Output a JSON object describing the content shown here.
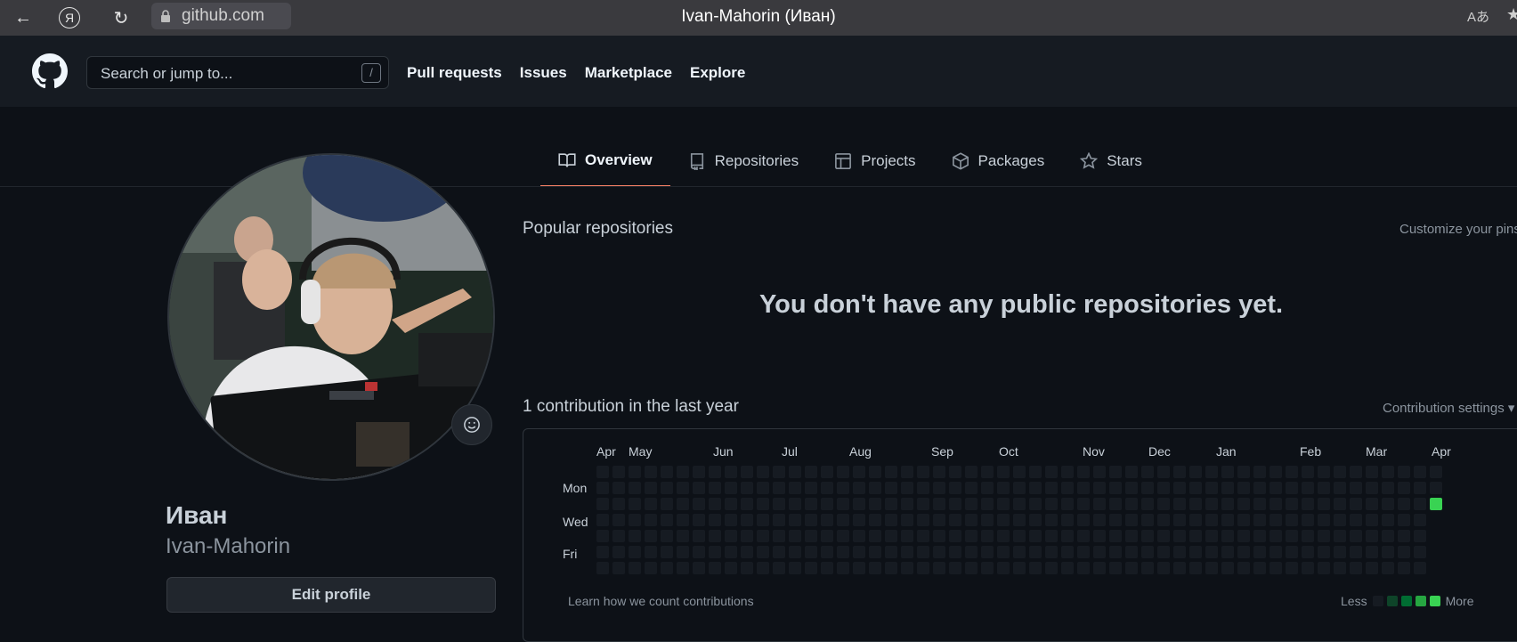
{
  "browser": {
    "url": "github.com",
    "window_title": "Ivan-Mahorin (Иван)",
    "back_glyph": "←",
    "yandex_glyph": "Я",
    "reload_glyph": "↻",
    "translate_glyph": "Aあ",
    "bookmark_glyph": "★"
  },
  "header": {
    "search_placeholder": "Search or jump to...",
    "search_shortcut": "/",
    "nav": [
      "Pull requests",
      "Issues",
      "Marketplace",
      "Explore"
    ]
  },
  "tabs": [
    {
      "label": "Overview",
      "icon": "book-icon",
      "active": true
    },
    {
      "label": "Repositories",
      "icon": "repo-icon",
      "active": false
    },
    {
      "label": "Projects",
      "icon": "table-icon",
      "active": false
    },
    {
      "label": "Packages",
      "icon": "package-icon",
      "active": false
    },
    {
      "label": "Stars",
      "icon": "star-icon",
      "active": false
    }
  ],
  "profile": {
    "name": "Иван",
    "login": "Ivan-Mahorin",
    "edit_label": "Edit profile"
  },
  "main": {
    "popular_title": "Popular repositories",
    "customize_label": "Customize your pins",
    "empty_message": "You don't have any public repositories yet.",
    "contrib_title": "1 contribution in the last year",
    "contrib_settings": "Contribution settings ▾"
  },
  "calendar": {
    "months": [
      "Apr",
      "May",
      "Jun",
      "Jul",
      "Aug",
      "Sep",
      "Oct",
      "Nov",
      "Dec",
      "Jan",
      "Feb",
      "Mar",
      "Apr"
    ],
    "day_labels": [
      "Mon",
      "Wed",
      "Fri"
    ],
    "weeks": 53,
    "contributions": [
      {
        "week": 52,
        "weekday": 2,
        "count": 1
      }
    ],
    "learn_link": "Learn how we count contributions",
    "legend_less": "Less",
    "legend_more": "More",
    "colors": {
      "empty": "#161b22",
      "level1": "#0e4429",
      "level2": "#006d32",
      "level3": "#26a641",
      "level4": "#39d353"
    }
  }
}
